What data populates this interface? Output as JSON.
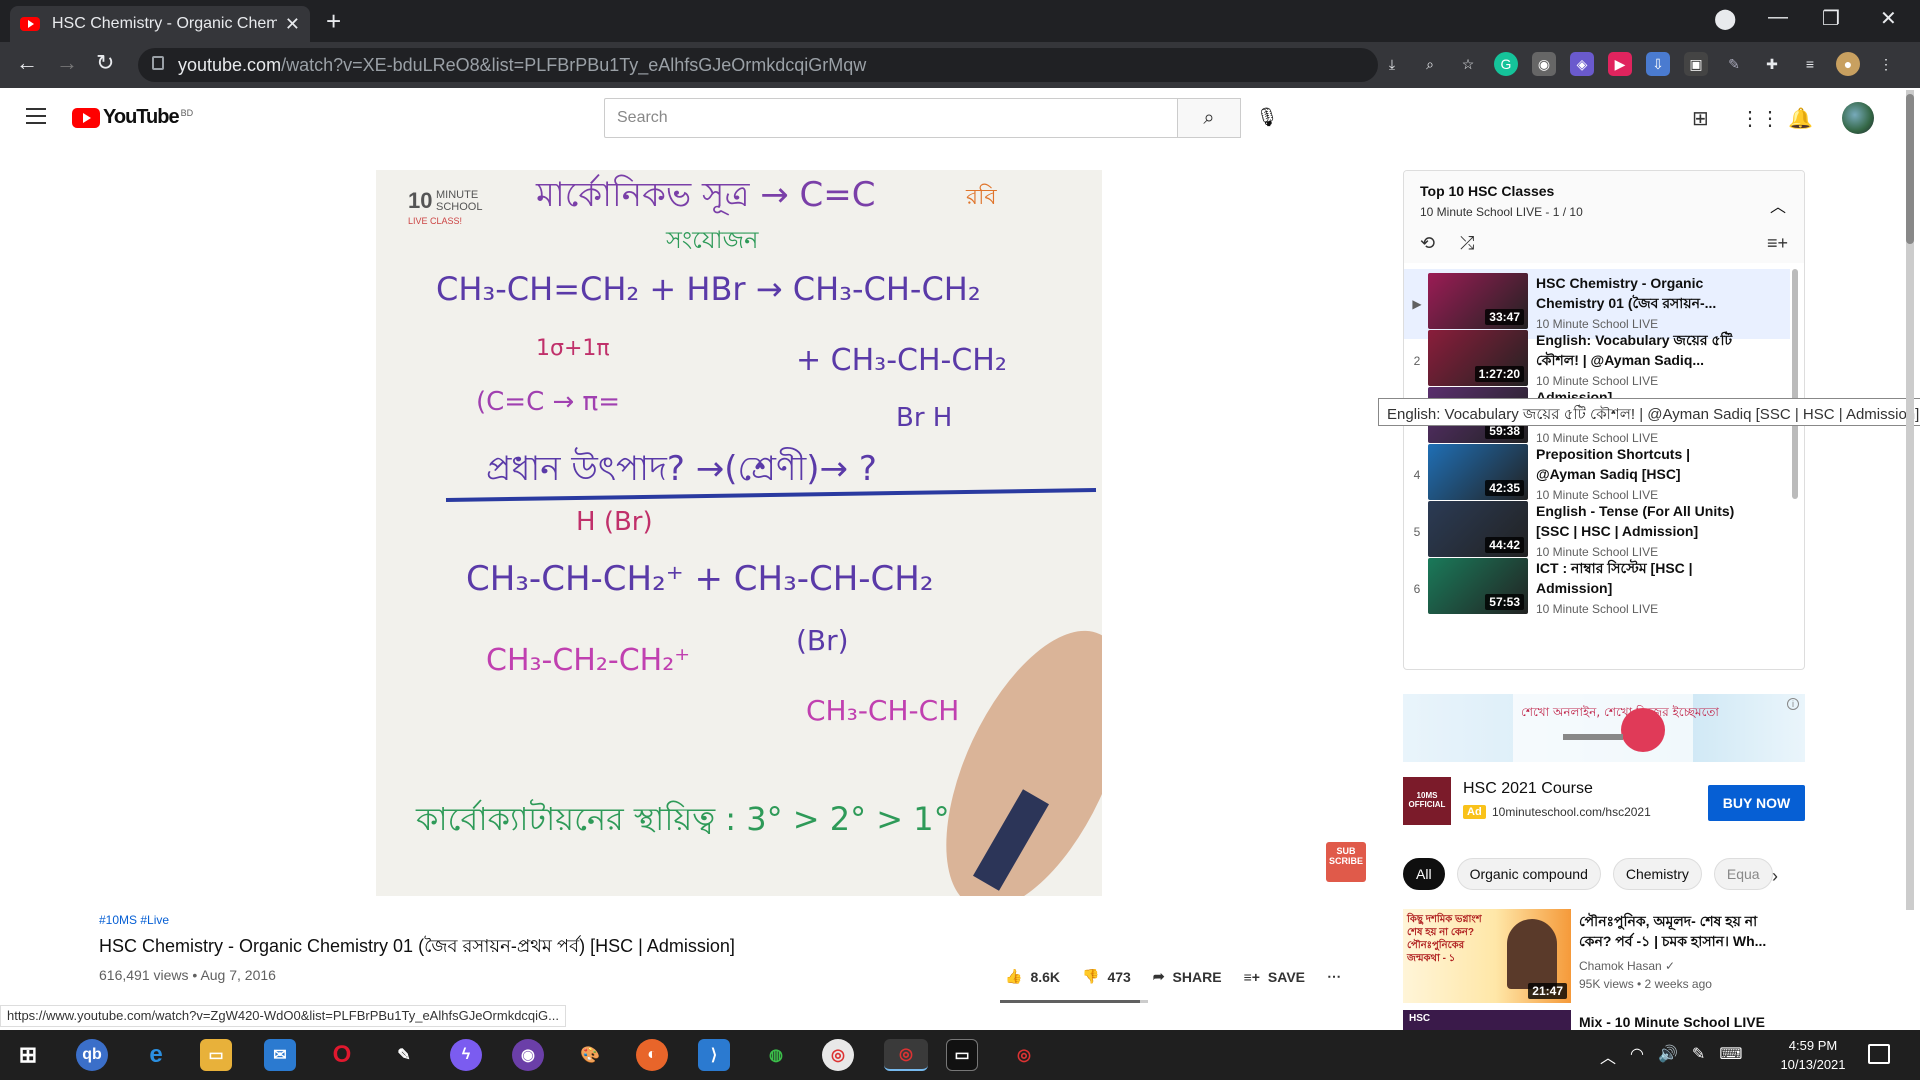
{
  "browser": {
    "tab_title": "HSC Chemistry - Organic Chemis",
    "tab_close": "✕",
    "new_tab": "+",
    "url_host": "youtube.com",
    "url_path": "/watch?v=XE-bduLReO8&list=PLFBrPBu1Ty_eAlhfsGJeOrmkdcqiGrMqw",
    "window_controls": [
      "—",
      "❐",
      "✕"
    ]
  },
  "youtube": {
    "logo_text": "YouTube",
    "country": "BD",
    "search_placeholder": "Search"
  },
  "video": {
    "tags": "#10MS #Live",
    "title": "HSC Chemistry - Organic Chemistry 01 (জৈব রসায়ন-প্রথম পর্ব) [HSC | Admission]",
    "views": "616,491 views",
    "date": "Aug 7, 2016",
    "likes": "8.6K",
    "dislikes": "473",
    "share": "SHARE",
    "save": "SAVE",
    "like_ratio": 0.948,
    "subscribe_badge": "SUB SCRIBE"
  },
  "status_url": "https://www.youtube.com/watch?v=ZgW420-WdO0&list=PLFBrPBu1Ty_eAlhfsGJeOrmkdcqiG...",
  "playlist": {
    "title": "Top 10 HSC Classes",
    "channel": "10 Minute School LIVE",
    "position": "1 / 10",
    "items": [
      {
        "num": "▶",
        "title": "HSC Chemistry - Organic Chemistry 01 (জৈব রসায়ন-...",
        "channel": "10 Minute School LIVE",
        "duration": "33:47",
        "color": "#9b1c55"
      },
      {
        "num": "2",
        "title": "English: Vocabulary জয়ের ৫টি কৌশল! | @Ayman Sadiq...",
        "channel": "10 Minute School LIVE",
        "duration": "1:27:20",
        "color": "#8a1d3b"
      },
      {
        "num": "3",
        "title": "Admission]",
        "channel": "10 Minute School LIVE",
        "duration": "59:38",
        "color": "#5a2f6e"
      },
      {
        "num": "4",
        "title": "Preposition Shortcuts | @Ayman Sadiq [HSC]",
        "channel": "10 Minute School LIVE",
        "duration": "42:35",
        "color": "#1f6fb5"
      },
      {
        "num": "5",
        "title": "English - Tense (For All Units) [SSC | HSC | Admission]",
        "channel": "10 Minute School LIVE",
        "duration": "44:42",
        "color": "#2b3b55"
      },
      {
        "num": "6",
        "title": "ICT : নাম্বার সিস্টেম [HSC | Admission]",
        "channel": "10 Minute School LIVE",
        "duration": "57:53",
        "color": "#1a7a5a"
      }
    ],
    "tooltip": "English: Vocabulary জয়ের ৫টি কৌশল! | @Ayman Sadiq [SSC | HSC | Admission]"
  },
  "ad": {
    "banner_text": "শেখো অনলাইন, শেখো নিজের ইচ্ছেমতো",
    "logo_text": "10MS OFFICIAL",
    "title": "HSC 2021 Course",
    "badge": "Ad",
    "url": "10minuteschool.com/hsc2021",
    "cta": "BUY NOW"
  },
  "chips": [
    "All",
    "Organic compound",
    "Chemistry",
    "Equa"
  ],
  "related": [
    {
      "title": "পৌনঃপুনিক, অমূলদ- শেষ হয় না কেন? পর্ব -১ | চমক হাসান। Wh...",
      "channel": "Chamok Hasan ✓",
      "meta": "95K views • 2 weeks ago",
      "duration": "21:47",
      "thumb_text": "কিছু দশমিক ভগ্নাংশ শেষ হয় না কেন? পৌনঃপুনিকের জন্মকথা - ১"
    },
    {
      "title": "Mix - 10 Minute School LIVE",
      "channel": "",
      "meta": "",
      "duration": "",
      "thumb_text": "HSC"
    }
  ],
  "taskbar": {
    "time": "4:59 PM",
    "date": "10/13/2021"
  },
  "colors": {
    "accent": "#065fd4",
    "brand_red": "#ff0000",
    "chrome_dark": "#202124"
  }
}
